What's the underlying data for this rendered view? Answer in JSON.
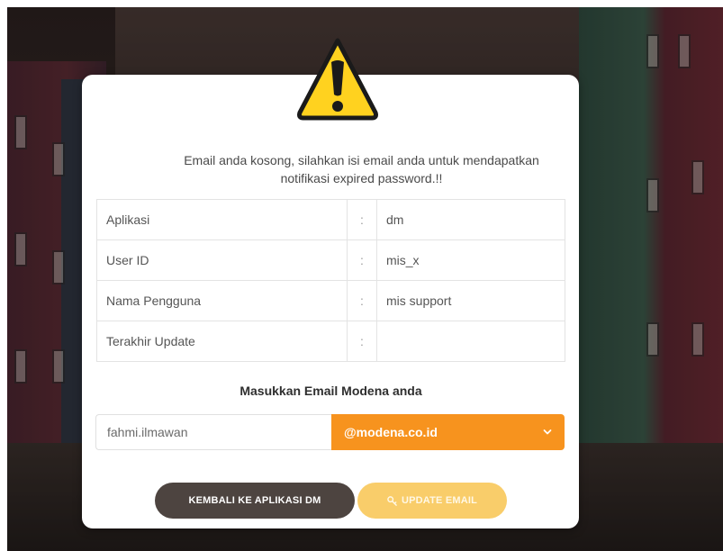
{
  "warning_icon": "warning-triangle-icon",
  "message": {
    "line1": "Email anda kosong, silahkan isi email anda untuk mendapatkan",
    "line2": "notifikasi expired password.!!"
  },
  "info_table": {
    "separator": ":",
    "rows": [
      {
        "label": "Aplikasi",
        "value": "dm"
      },
      {
        "label": "User ID",
        "value": "mis_x"
      },
      {
        "label": "Nama Pengguna",
        "value": "mis support"
      },
      {
        "label": "Terakhir Update",
        "value": ""
      }
    ]
  },
  "email_section": {
    "title": "Masukkan Email Modena anda",
    "input_value": "fahmi.ilmawan",
    "domain_selected": "@modena.co.id"
  },
  "buttons": {
    "back_label": "KEMBALI KE APLIKASI DM",
    "update_label": "UPDATE EMAIL",
    "update_icon": "key-icon"
  },
  "colors": {
    "accent_orange": "#f7931e",
    "update_button": "#f9cd6a",
    "back_button": "#4d4440",
    "warning_yellow": "#ffd21f"
  }
}
